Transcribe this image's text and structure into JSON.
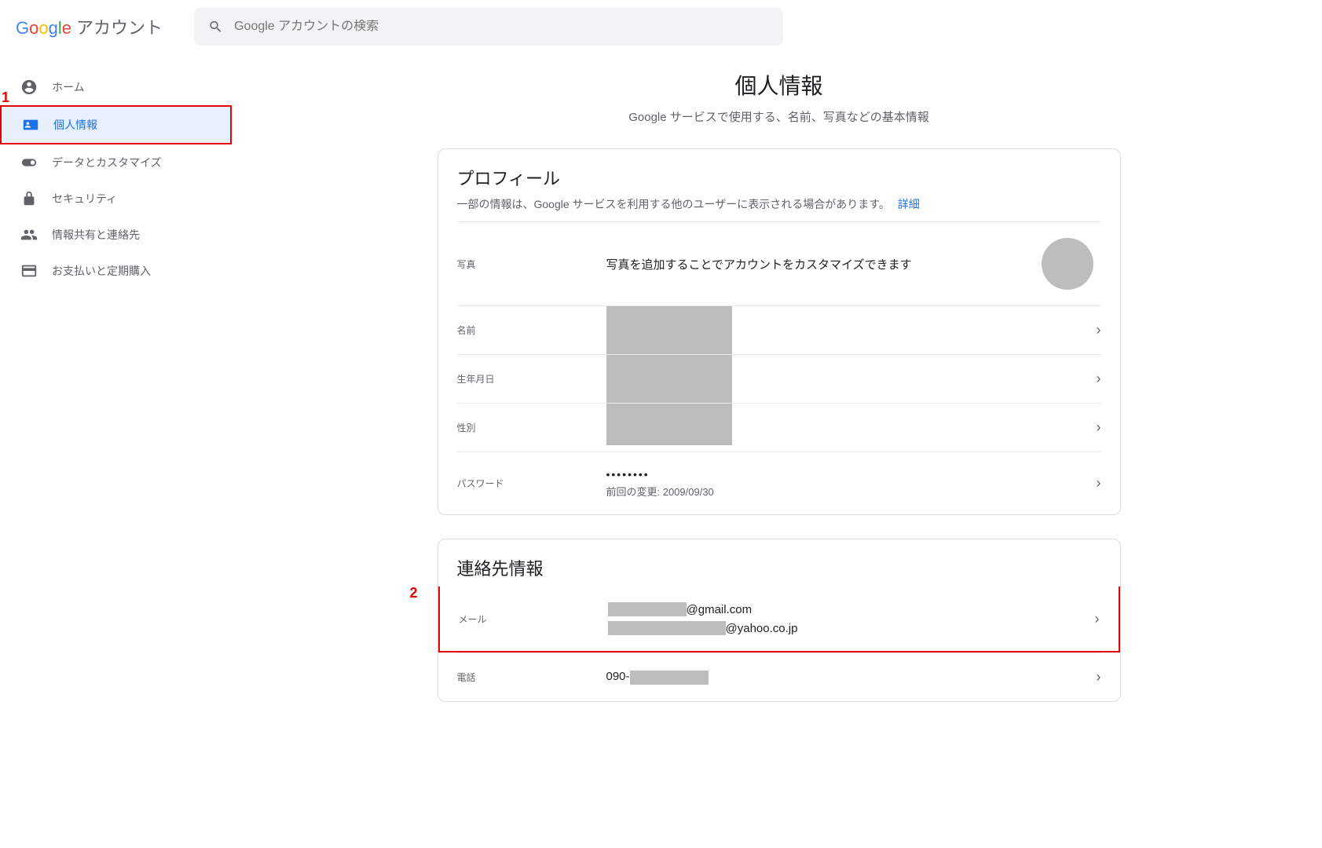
{
  "header": {
    "logo_letters": [
      "G",
      "o",
      "o",
      "g",
      "l",
      "e"
    ],
    "account_word": "アカウント",
    "search_placeholder": "Google アカウントの検索"
  },
  "annotations": {
    "num1": "1",
    "num2": "2"
  },
  "sidebar": {
    "items": [
      {
        "id": "home",
        "label": "ホーム"
      },
      {
        "id": "personal",
        "label": "個人情報"
      },
      {
        "id": "data",
        "label": "データとカスタマイズ"
      },
      {
        "id": "security",
        "label": "セキュリティ"
      },
      {
        "id": "sharing",
        "label": "情報共有と連絡先"
      },
      {
        "id": "payments",
        "label": "お支払いと定期購入"
      }
    ]
  },
  "page": {
    "title": "個人情報",
    "subtitle": "Google サービスで使用する、名前、写真などの基本情報"
  },
  "profile": {
    "card_title": "プロフィール",
    "card_desc": "一部の情報は、Google サービスを利用する他のユーザーに表示される場合があります。",
    "card_desc_link": "詳細",
    "photo": {
      "label": "写真",
      "value": "写真を追加することでアカウントをカスタマイズできます"
    },
    "name": {
      "label": "名前"
    },
    "birthday": {
      "label": "生年月日"
    },
    "gender": {
      "label": "性別"
    },
    "password": {
      "label": "パスワード",
      "dots": "••••••••",
      "last_changed": "前回の変更: 2009/09/30"
    }
  },
  "contact": {
    "card_title": "連絡先情報",
    "email": {
      "label": "メール",
      "suffix1": "@gmail.com",
      "suffix2": "@yahoo.co.jp"
    },
    "phone": {
      "label": "電話",
      "prefix": "090-"
    }
  }
}
